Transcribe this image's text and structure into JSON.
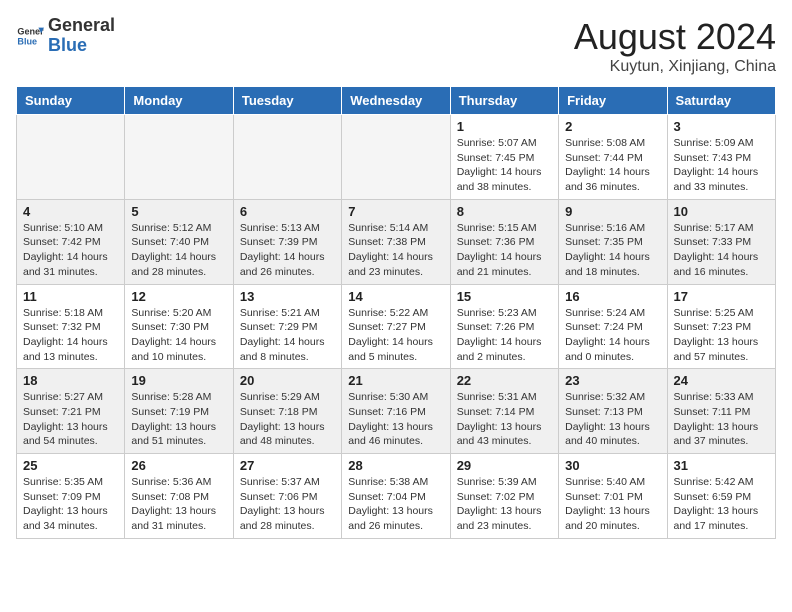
{
  "header": {
    "logo_line1": "General",
    "logo_line2": "Blue",
    "month_year": "August 2024",
    "location": "Kuytun, Xinjiang, China"
  },
  "weekdays": [
    "Sunday",
    "Monday",
    "Tuesday",
    "Wednesday",
    "Thursday",
    "Friday",
    "Saturday"
  ],
  "weeks": [
    [
      {
        "day": "",
        "info": ""
      },
      {
        "day": "",
        "info": ""
      },
      {
        "day": "",
        "info": ""
      },
      {
        "day": "",
        "info": ""
      },
      {
        "day": "1",
        "info": "Sunrise: 5:07 AM\nSunset: 7:45 PM\nDaylight: 14 hours\nand 38 minutes."
      },
      {
        "day": "2",
        "info": "Sunrise: 5:08 AM\nSunset: 7:44 PM\nDaylight: 14 hours\nand 36 minutes."
      },
      {
        "day": "3",
        "info": "Sunrise: 5:09 AM\nSunset: 7:43 PM\nDaylight: 14 hours\nand 33 minutes."
      }
    ],
    [
      {
        "day": "4",
        "info": "Sunrise: 5:10 AM\nSunset: 7:42 PM\nDaylight: 14 hours\nand 31 minutes."
      },
      {
        "day": "5",
        "info": "Sunrise: 5:12 AM\nSunset: 7:40 PM\nDaylight: 14 hours\nand 28 minutes."
      },
      {
        "day": "6",
        "info": "Sunrise: 5:13 AM\nSunset: 7:39 PM\nDaylight: 14 hours\nand 26 minutes."
      },
      {
        "day": "7",
        "info": "Sunrise: 5:14 AM\nSunset: 7:38 PM\nDaylight: 14 hours\nand 23 minutes."
      },
      {
        "day": "8",
        "info": "Sunrise: 5:15 AM\nSunset: 7:36 PM\nDaylight: 14 hours\nand 21 minutes."
      },
      {
        "day": "9",
        "info": "Sunrise: 5:16 AM\nSunset: 7:35 PM\nDaylight: 14 hours\nand 18 minutes."
      },
      {
        "day": "10",
        "info": "Sunrise: 5:17 AM\nSunset: 7:33 PM\nDaylight: 14 hours\nand 16 minutes."
      }
    ],
    [
      {
        "day": "11",
        "info": "Sunrise: 5:18 AM\nSunset: 7:32 PM\nDaylight: 14 hours\nand 13 minutes."
      },
      {
        "day": "12",
        "info": "Sunrise: 5:20 AM\nSunset: 7:30 PM\nDaylight: 14 hours\nand 10 minutes."
      },
      {
        "day": "13",
        "info": "Sunrise: 5:21 AM\nSunset: 7:29 PM\nDaylight: 14 hours\nand 8 minutes."
      },
      {
        "day": "14",
        "info": "Sunrise: 5:22 AM\nSunset: 7:27 PM\nDaylight: 14 hours\nand 5 minutes."
      },
      {
        "day": "15",
        "info": "Sunrise: 5:23 AM\nSunset: 7:26 PM\nDaylight: 14 hours\nand 2 minutes."
      },
      {
        "day": "16",
        "info": "Sunrise: 5:24 AM\nSunset: 7:24 PM\nDaylight: 14 hours\nand 0 minutes."
      },
      {
        "day": "17",
        "info": "Sunrise: 5:25 AM\nSunset: 7:23 PM\nDaylight: 13 hours\nand 57 minutes."
      }
    ],
    [
      {
        "day": "18",
        "info": "Sunrise: 5:27 AM\nSunset: 7:21 PM\nDaylight: 13 hours\nand 54 minutes."
      },
      {
        "day": "19",
        "info": "Sunrise: 5:28 AM\nSunset: 7:19 PM\nDaylight: 13 hours\nand 51 minutes."
      },
      {
        "day": "20",
        "info": "Sunrise: 5:29 AM\nSunset: 7:18 PM\nDaylight: 13 hours\nand 48 minutes."
      },
      {
        "day": "21",
        "info": "Sunrise: 5:30 AM\nSunset: 7:16 PM\nDaylight: 13 hours\nand 46 minutes."
      },
      {
        "day": "22",
        "info": "Sunrise: 5:31 AM\nSunset: 7:14 PM\nDaylight: 13 hours\nand 43 minutes."
      },
      {
        "day": "23",
        "info": "Sunrise: 5:32 AM\nSunset: 7:13 PM\nDaylight: 13 hours\nand 40 minutes."
      },
      {
        "day": "24",
        "info": "Sunrise: 5:33 AM\nSunset: 7:11 PM\nDaylight: 13 hours\nand 37 minutes."
      }
    ],
    [
      {
        "day": "25",
        "info": "Sunrise: 5:35 AM\nSunset: 7:09 PM\nDaylight: 13 hours\nand 34 minutes."
      },
      {
        "day": "26",
        "info": "Sunrise: 5:36 AM\nSunset: 7:08 PM\nDaylight: 13 hours\nand 31 minutes."
      },
      {
        "day": "27",
        "info": "Sunrise: 5:37 AM\nSunset: 7:06 PM\nDaylight: 13 hours\nand 28 minutes."
      },
      {
        "day": "28",
        "info": "Sunrise: 5:38 AM\nSunset: 7:04 PM\nDaylight: 13 hours\nand 26 minutes."
      },
      {
        "day": "29",
        "info": "Sunrise: 5:39 AM\nSunset: 7:02 PM\nDaylight: 13 hours\nand 23 minutes."
      },
      {
        "day": "30",
        "info": "Sunrise: 5:40 AM\nSunset: 7:01 PM\nDaylight: 13 hours\nand 20 minutes."
      },
      {
        "day": "31",
        "info": "Sunrise: 5:42 AM\nSunset: 6:59 PM\nDaylight: 13 hours\nand 17 minutes."
      }
    ]
  ]
}
